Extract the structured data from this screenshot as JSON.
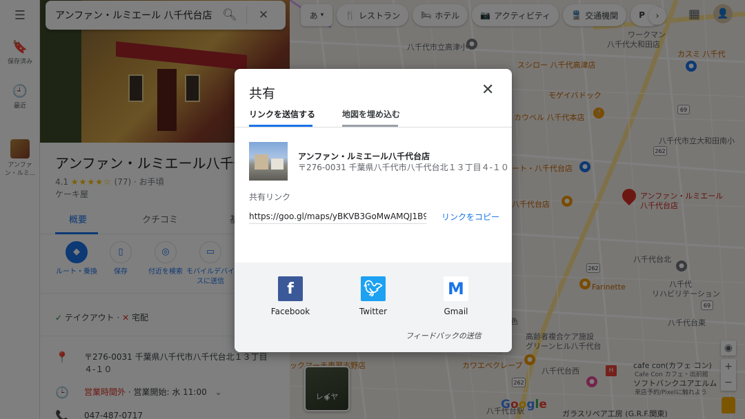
{
  "search": {
    "query": "アンファン・ルミエール 八千代台店"
  },
  "rail": {
    "items": [
      {
        "label": "保存済み",
        "icon": "bookmark-icon"
      },
      {
        "label": "最近",
        "icon": "history-icon"
      },
      {
        "label": "アンファン・ルミ...",
        "icon": "place-thumb"
      }
    ]
  },
  "place": {
    "title": "アンファン・ルミエール八千代",
    "rating": "4.1",
    "stars": "★★★★☆",
    "review_count": "(77)",
    "price": "· お手頃",
    "category": "ケーキ屋",
    "tabs": [
      "概要",
      "クチコミ",
      "基"
    ],
    "actions": [
      {
        "label": "ルート・乗換",
        "icon": "directions-icon"
      },
      {
        "label": "保存",
        "icon": "bookmark-icon"
      },
      {
        "label": "付近を検索",
        "icon": "nearby-icon"
      },
      {
        "label": "モバイルデバイスに送信",
        "icon": "send-to-phone-icon"
      }
    ],
    "takeout": "テイクアウト",
    "takeout_sep": "·",
    "delivery": "宅配",
    "address": "〒276-0031 千葉県八千代市八千代台北１３丁目４-１０",
    "hours_status": "営業時間外",
    "hours_next": "· 営業開始: 水 11:00",
    "phone": "047-487-0717"
  },
  "chips": [
    {
      "label": "あ",
      "icon": ""
    },
    {
      "label": "レストラン",
      "icon": "restaurant-icon"
    },
    {
      "label": "ホテル",
      "icon": "hotel-icon"
    },
    {
      "label": "アクティビティ",
      "icon": "camera-icon"
    },
    {
      "label": "交通機関",
      "icon": "transit-icon"
    },
    {
      "label": "P",
      "icon": "parking-icon"
    }
  ],
  "map": {
    "labels": [
      {
        "text": "八千代市立高津小",
        "class": ""
      },
      {
        "text": "ワークマン",
        "class": ""
      },
      {
        "text": "八千代大和田店",
        "class": ""
      },
      {
        "text": "カスミ 八千代",
        "class": "orange"
      },
      {
        "text": "スシロー 八千代高津店",
        "class": "orange"
      },
      {
        "text": "モゲイバドック",
        "class": "orange"
      },
      {
        "text": "カウベル 八千代本店",
        "class": "orange"
      },
      {
        "text": "八千代市立大和田南小",
        "class": ""
      },
      {
        "text": "ート・八千代台店",
        "class": "orange"
      },
      {
        "text": "八千代台店",
        "class": "orange"
      },
      {
        "text": "アンファン・ルミエール",
        "class": "red"
      },
      {
        "text": "八千代台店",
        "class": "red"
      },
      {
        "text": "八千代台北",
        "class": ""
      },
      {
        "text": "Farinette",
        "class": "orange"
      },
      {
        "text": "八千代",
        "class": ""
      },
      {
        "text": "リハビリテーション",
        "class": ""
      },
      {
        "text": "八千代台東",
        "class": ""
      },
      {
        "text": "高齢者複合ケア施設",
        "class": ""
      },
      {
        "text": "グリーンヒル八千代台",
        "class": ""
      },
      {
        "text": "カワエベクレープ",
        "class": "orange"
      },
      {
        "text": "cafe con(カフェ コン)",
        "class": "dark"
      },
      {
        "text": "Cafe Con カフェ・出前館",
        "class": ""
      },
      {
        "text": "ソフトバンクユアエルム",
        "class": "dark"
      },
      {
        "text": "来店予約/Pixelに触れよう",
        "class": ""
      },
      {
        "text": "ガラスリペア工房 (G.R.F.関東)",
        "class": "dark"
      },
      {
        "text": "八千代台西",
        "class": ""
      },
      {
        "text": "八千代台駅",
        "class": ""
      },
      {
        "text": "ックマーチ東習志野店",
        "class": "orange"
      },
      {
        "text": "色",
        "class": ""
      }
    ],
    "road_badges": [
      "69",
      "262",
      "262",
      "262",
      "69"
    ],
    "layer_label": "レイヤ",
    "zoom_in": "+",
    "zoom_out": "−"
  },
  "dialog": {
    "title": "共有",
    "tabs": [
      "リンクを送信する",
      "地図を埋め込む"
    ],
    "place_name": "アンファン・ルミエール八千代台店",
    "place_address": "〒276-0031 千葉県八千代市八千代台北１３丁目４-１０",
    "share_label": "共有リンク",
    "share_url": "https://goo.gl/maps/yBKVB3GoMwAMQJ1B9",
    "copy_label": "リンクをコピー",
    "socials": [
      {
        "name": "Facebook",
        "icon": "facebook-icon"
      },
      {
        "name": "Twitter",
        "icon": "twitter-icon"
      },
      {
        "name": "Gmail",
        "icon": "gmail-icon"
      }
    ],
    "feedback": "フィードバックの送信"
  },
  "colors": {
    "accent": "#1a73e8",
    "closed": "#d93025",
    "pin": "#d93025"
  }
}
